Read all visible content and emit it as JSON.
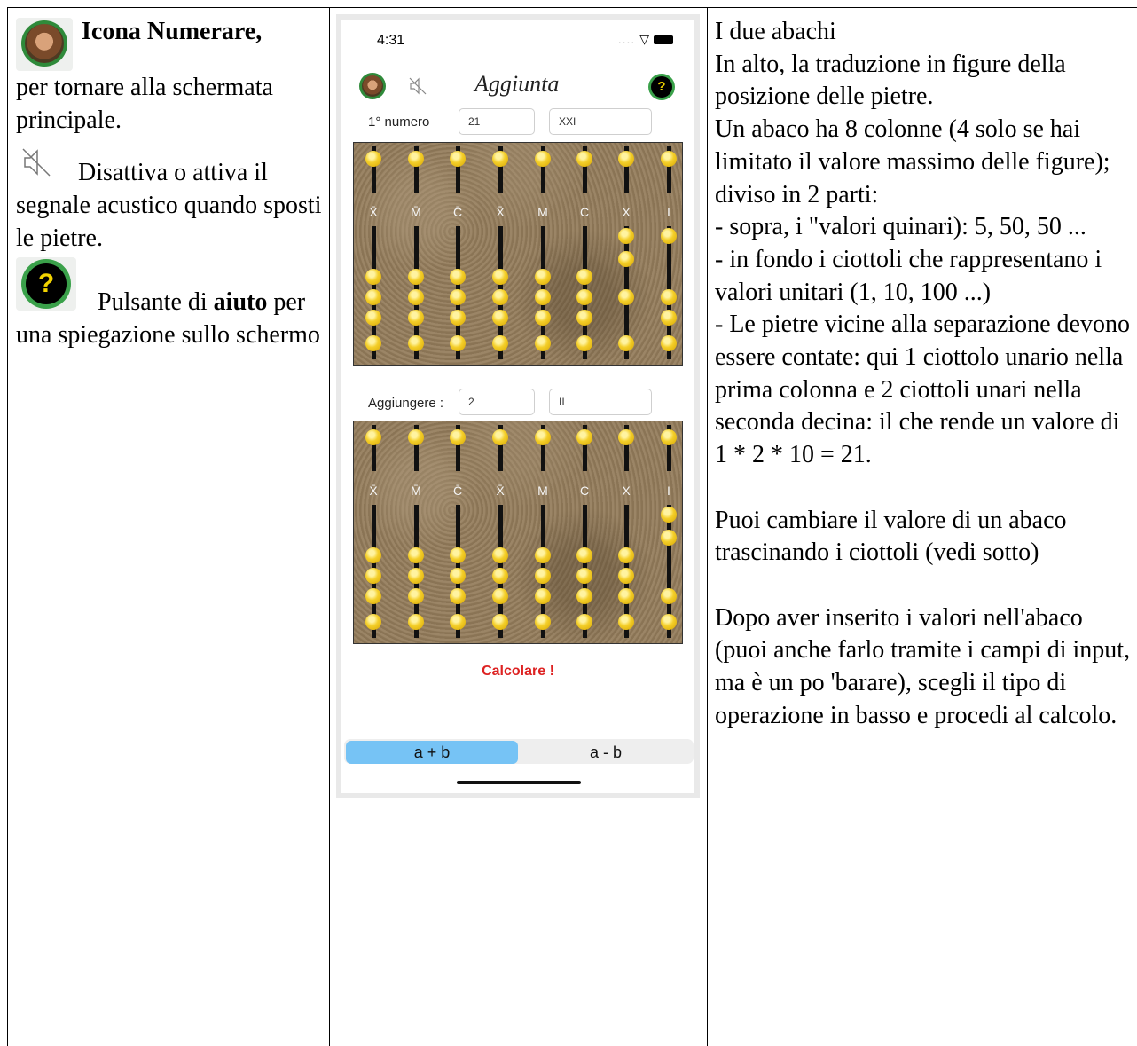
{
  "left": {
    "icon_title": "Icona Numerare,",
    "icon_desc": "per tornare alla schermata principale.",
    "mute_desc": "Disattiva o attiva il segnale acustico quando sposti le pietre.",
    "help_prefix": "Pulsante di ",
    "help_bold": "aiuto",
    "help_suffix": " per una spiegazione sullo schermo"
  },
  "phone": {
    "time": "4:31",
    "status_dots": "....",
    "title": "Aggiunta",
    "row1_label": "1° numero",
    "row1_value": "21",
    "row1_roman": "XXI",
    "row2_label": "Aggiungere :",
    "row2_value": "2",
    "row2_roman": "II",
    "column_labels": [
      "X̄",
      "M̄",
      "C̄",
      "X̄",
      "M",
      "C",
      "X",
      "I"
    ],
    "calculate": "Calcolare !",
    "op_add": "a + b",
    "op_sub": "a - b",
    "help_glyph": "?"
  },
  "right": {
    "p1": "I due abachi",
    "p2": "In alto, la traduzione in figure della posizione delle pietre.",
    "p3": "Un abaco ha 8 colonne (4 solo se hai limitato il valore massimo delle figure); diviso in 2 parti:",
    "p4": "- sopra, i \"valori quinari): 5, 50, 50 ...",
    "p5": "- in fondo i ciottoli che rappresentano i valori unitari (1, 10, 100 ...)",
    "p6": "- Le pietre vicine alla separazione devono essere contate: qui 1 ciottolo unario nella prima colonna e 2 ciottoli unari nella seconda decina: il che rende un valore di 1 * 2 * 10 = 21.",
    "p7": "Puoi cambiare il valore di un abaco trascinando i ciottoli (vedi sotto)",
    "p8": "Dopo aver inserito i valori nell'abaco (puoi anche farlo tramite i campi di input, ma è un po 'barare), scegli il tipo di operazione in basso e procedi al calcolo."
  }
}
